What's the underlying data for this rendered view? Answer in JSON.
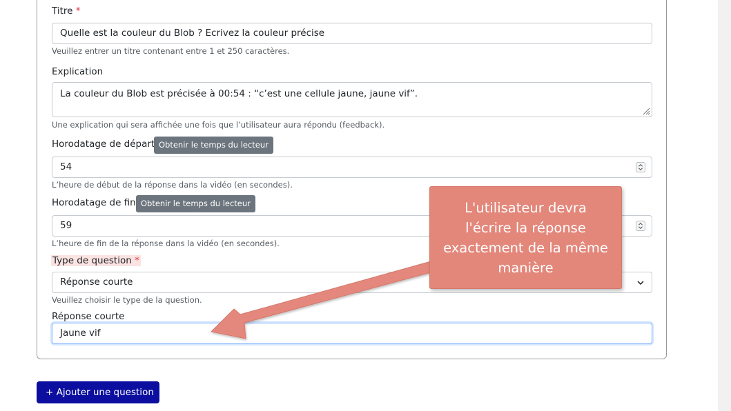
{
  "form": {
    "title_label": "Titre",
    "required_mark": "*",
    "title_value": "Quelle est la couleur du Blob ? Ecrivez la couleur précise",
    "title_help": "Veuillez entrer un titre contenant entre 1 et 250 caractères.",
    "explanation_label": "Explication",
    "explanation_value": "La couleur du Blob est précisée à 00:54 : “c’est une cellule jaune, jaune vif”.",
    "explanation_help": "Une explication qui sera affichée une fois que l’utilisateur aura répondu (feedback).",
    "start_label": "Horodatage de départ",
    "get_time_button": "Obtenir le temps du lecteur",
    "start_value": "54",
    "start_help": "L’heure de début de la réponse dans la vidéo (en secondes).",
    "end_label": "Horodatage de fin",
    "end_value": "59",
    "end_help": "L’heure de fin de la réponse dans la vidéo (en secondes).",
    "type_label": "Type de question",
    "type_value": "Réponse courte",
    "type_help": "Veuillez choisir le type de la question.",
    "short_answer_label": "Réponse courte",
    "short_answer_value": "Jaune vif"
  },
  "add_question_button": "+ Ajouter une question",
  "callout": {
    "lines": [
      "L'utilisateur devra",
      "l'écrire la réponse",
      "exactement de la même",
      "manière"
    ],
    "color": "#e4877b"
  },
  "icons": {
    "spinner": "number-spinner-icon",
    "select": "chevron-down-icon",
    "resize": "resize-handle-icon",
    "arrow": "callout-arrow"
  }
}
